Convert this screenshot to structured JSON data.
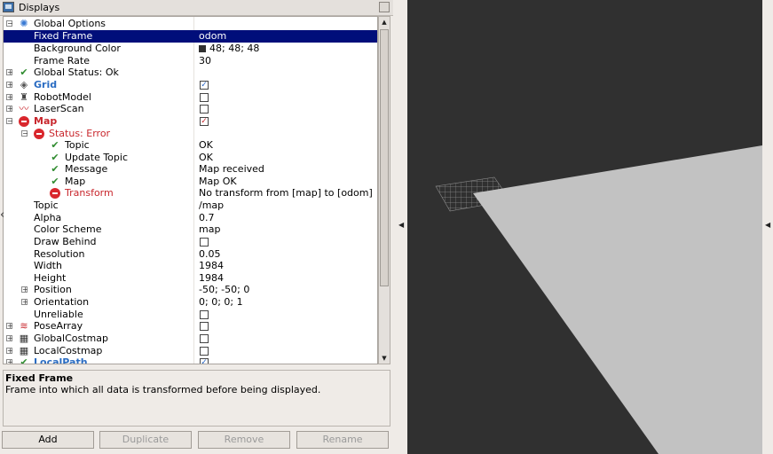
{
  "window": {
    "title": "Displays"
  },
  "tree": {
    "global_options": {
      "label": "Global Options"
    },
    "fixed_frame": {
      "label": "Fixed Frame",
      "value": "odom"
    },
    "background_color": {
      "label": "Background Color",
      "value": "48; 48; 48",
      "color": "#303030"
    },
    "frame_rate": {
      "label": "Frame Rate",
      "value": "30"
    },
    "global_status": {
      "label": "Global Status: Ok"
    },
    "grid": {
      "label": "Grid",
      "checked": true
    },
    "robot_model": {
      "label": "RobotModel",
      "checked": false
    },
    "laser_scan": {
      "label": "LaserScan",
      "checked": false
    },
    "map": {
      "label": "Map",
      "checked": true
    },
    "status_error": {
      "label": "Status: Error"
    },
    "status_topic": {
      "label": "Topic",
      "value": "OK"
    },
    "status_update_topic": {
      "label": "Update Topic",
      "value": "OK"
    },
    "status_message": {
      "label": "Message",
      "value": "Map received"
    },
    "status_map": {
      "label": "Map",
      "value": "Map OK"
    },
    "status_transform": {
      "label": "Transform",
      "value": "No transform from [map] to [odom]"
    },
    "topic": {
      "label": "Topic",
      "value": "/map"
    },
    "alpha": {
      "label": "Alpha",
      "value": "0.7"
    },
    "color_scheme": {
      "label": "Color Scheme",
      "value": "map"
    },
    "draw_behind": {
      "label": "Draw Behind",
      "checked": false
    },
    "resolution": {
      "label": "Resolution",
      "value": "0.05"
    },
    "width": {
      "label": "Width",
      "value": "1984"
    },
    "height": {
      "label": "Height",
      "value": "1984"
    },
    "position": {
      "label": "Position",
      "value": "-50; -50; 0"
    },
    "orientation": {
      "label": "Orientation",
      "value": "0; 0; 0; 1"
    },
    "unreliable": {
      "label": "Unreliable",
      "checked": false
    },
    "pose_array": {
      "label": "PoseArray",
      "checked": false
    },
    "global_costmap": {
      "label": "GlobalCostmap",
      "checked": false
    },
    "local_costmap": {
      "label": "LocalCostmap",
      "checked": false
    },
    "local_path": {
      "label": "LocalPath",
      "checked": true
    }
  },
  "description": {
    "title": "Fixed Frame",
    "text": "Frame into which all data is transformed before being displayed."
  },
  "buttons": {
    "add": "Add",
    "duplicate": "Duplicate",
    "remove": "Remove",
    "rename": "Rename"
  },
  "colors": {
    "selection": "#000e7a",
    "error": "#c8262c",
    "ok": "#2e8b2e",
    "link": "#2a6cc2",
    "viewport_bg": "#303030",
    "map_plane": "#c2c2c2"
  }
}
